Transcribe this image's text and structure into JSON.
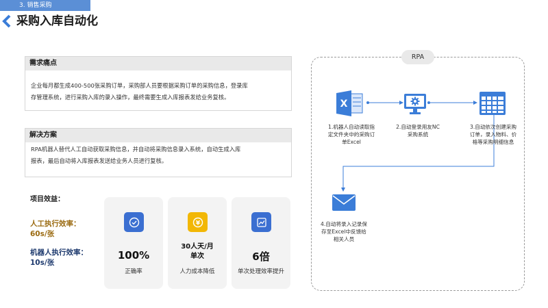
{
  "header": {
    "tab_label": "3. 销售采购",
    "title": "采购入库自动化"
  },
  "pain_points": {
    "heading": "需求痛点",
    "lines": [
      "企业每月都生成400-500张采购订单，采购部人员要根据采购订单的采购信息，登录库",
      "存管理系统，进行采购入库的录入操作，最终需要生成入库报表发给业务复核。"
    ]
  },
  "solution": {
    "heading": "解决方案",
    "lines": [
      "RPA机器人替代人工自动获取采购信息，并自动将采购信息录入系统，自动生成入库",
      "报表，最后自动将入库报表发送给业务人员进行复核。"
    ]
  },
  "benefits": {
    "title": "项目效益：",
    "human_efficiency": [
      "人工执行效率：",
      "60s/张"
    ],
    "robot_efficiency": [
      "机器人执行效率：",
      "10s/张"
    ],
    "cards": [
      {
        "icon": "check-circle-icon",
        "color": "#3b6fd1",
        "value": "100%",
        "desc": "正确率"
      },
      {
        "icon": "yen-coin-icon",
        "color": "#f2b705",
        "value": [
          "30人天/月",
          "单次"
        ],
        "desc": "人力成本降低"
      },
      {
        "icon": "trend-chart-icon",
        "color": "#3b6fd1",
        "value": "6倍",
        "desc": "单次处理效率提升"
      }
    ]
  },
  "rpa": {
    "badge": "RPA",
    "steps": [
      {
        "icon": "excel-icon",
        "lines": [
          "1.机器人自动读取指",
          "定文件夹中的采购订",
          "单Excel"
        ]
      },
      {
        "icon": "monitor-gear-icon",
        "lines": [
          "2.自动登录用友NC",
          "采购系统"
        ]
      },
      {
        "icon": "spreadsheet-grid-icon",
        "lines": [
          "3.自动依次创建采购",
          "订单，录入物料、价",
          "格等采购明细信息"
        ]
      },
      {
        "icon": "mail-icon",
        "lines": [
          "4.自动将录入记录保",
          "存至Excel中反馈给",
          "相关人员"
        ]
      }
    ]
  },
  "colors": {
    "accent": "#3b7dd8",
    "tab": "#5b8fd6",
    "gold": "#9a6a10",
    "navy": "#1e3a6e",
    "yellow": "#f2b705"
  }
}
